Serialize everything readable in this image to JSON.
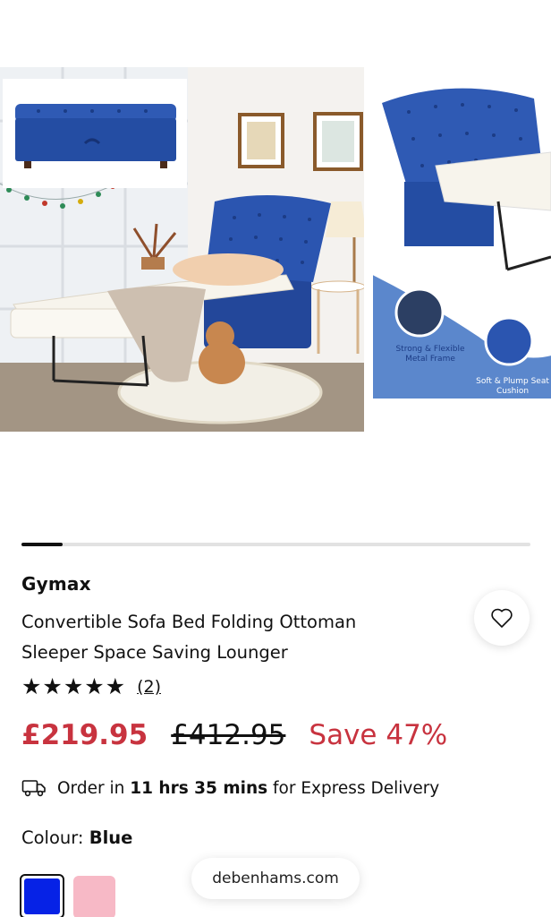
{
  "gallery": {
    "images": [
      {
        "name": "room-scene-product-photo",
        "inset": "ottoman-closed-inset"
      },
      {
        "name": "product-features-photo",
        "features": [
          "Strong & Flexible Metal Frame",
          "Soft & Plump Seat Cushion"
        ]
      }
    ],
    "progress_fraction": 0.08
  },
  "product": {
    "brand": "Gymax",
    "title_line1": "Convertible Sofa Bed Folding Ottoman",
    "title_line2": "Sleeper Space Saving Lounger",
    "rating": 5,
    "stars": "★★★★★",
    "review_count": "(2)",
    "price_now": "£219.95",
    "price_was": "£412.95",
    "save_label": "Save 47%"
  },
  "delivery": {
    "prefix": "Order in",
    "time": "11 hrs 35 mins",
    "suffix": "for Express Delivery",
    "icon": "delivery-van-icon"
  },
  "colour": {
    "label": "Colour:",
    "value": "Blue",
    "swatches": [
      {
        "name": "Blue",
        "color": "#0622e6",
        "selected": true
      },
      {
        "name": "Pink",
        "color": "#f7b9c6",
        "selected": false
      }
    ]
  },
  "browser": {
    "url": "debenhams.com"
  },
  "colors": {
    "sale": "#c8333f",
    "text": "#111111"
  }
}
